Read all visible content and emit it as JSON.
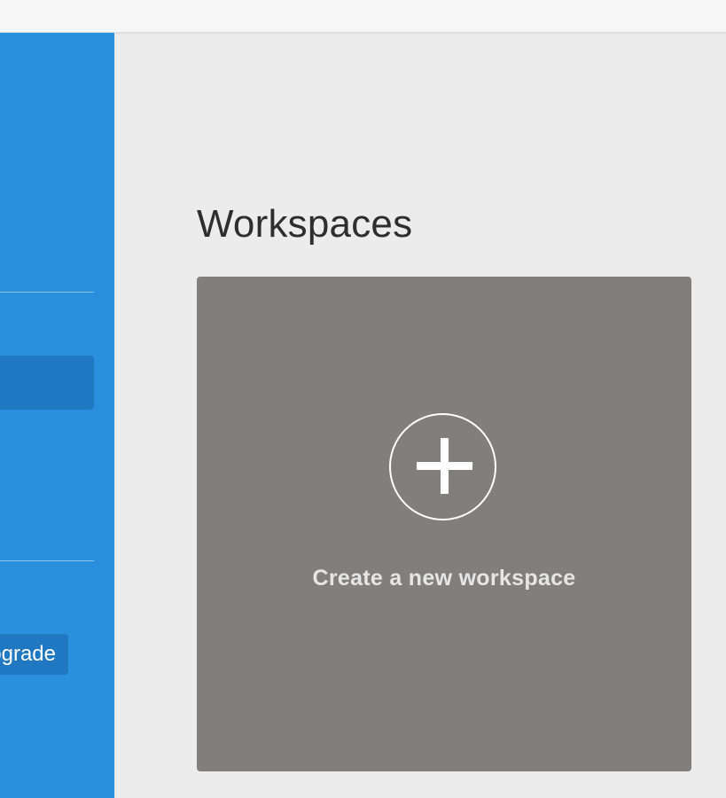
{
  "sidebar": {
    "upgrade_label": "Upgrade"
  },
  "main": {
    "title": "Workspaces",
    "create_card": {
      "label": "Create a new workspace",
      "icon": "plus-circle-icon"
    }
  },
  "colors": {
    "sidebar_bg": "#2a90dd",
    "sidebar_active": "#1f78c1",
    "page_bg": "#ececec",
    "card_bg": "#807f7e"
  }
}
